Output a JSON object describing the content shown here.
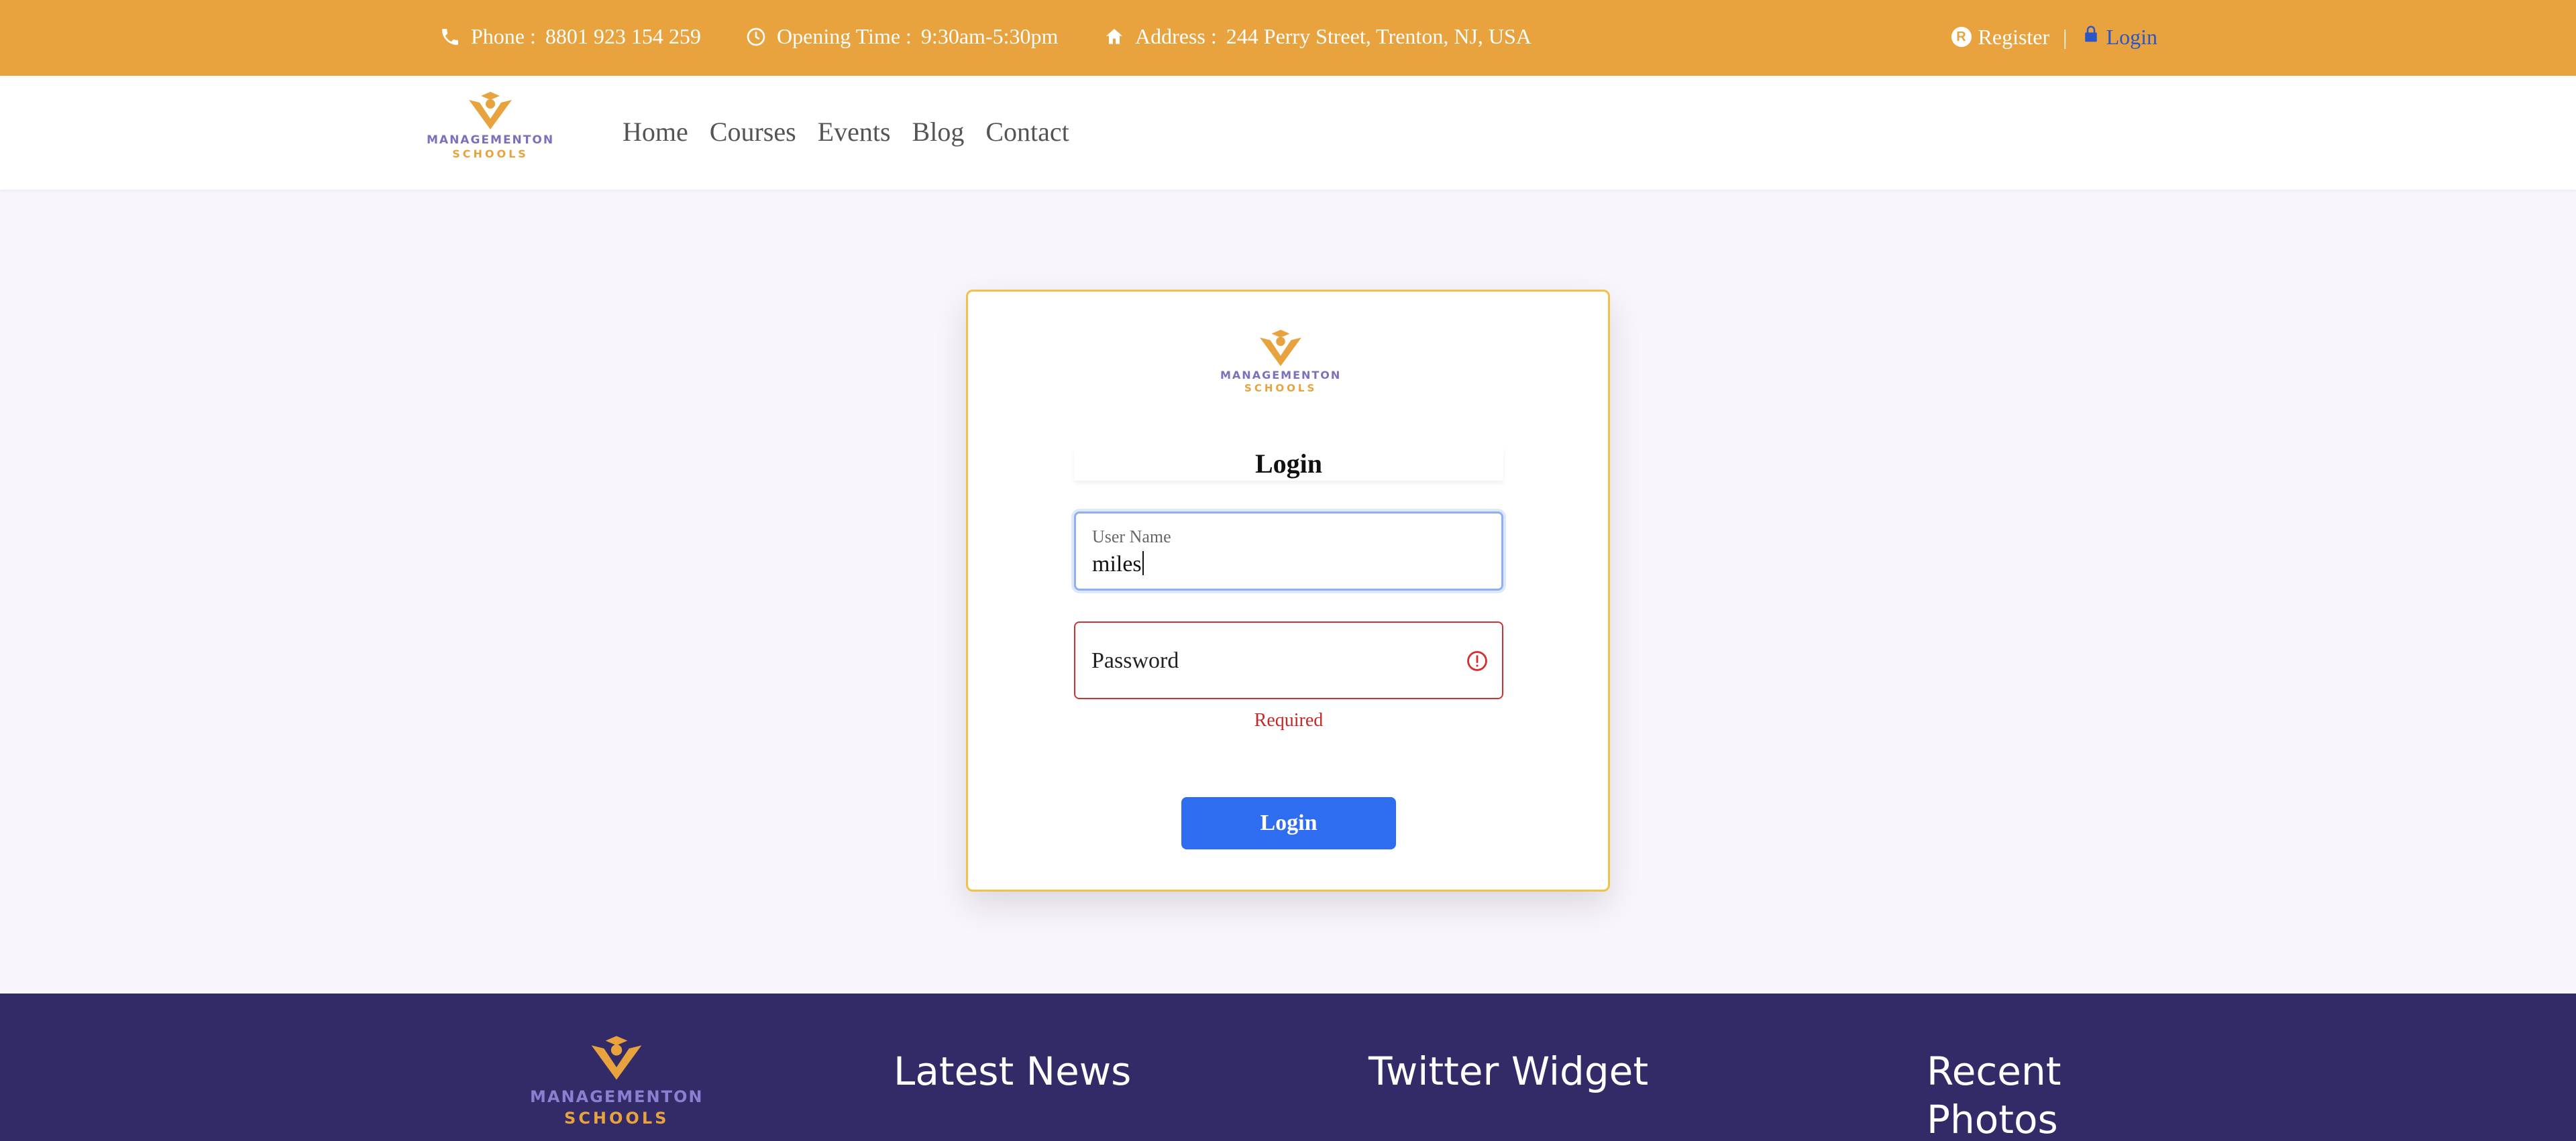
{
  "topbar": {
    "phone_label": "Phone :",
    "phone_value": "8801 923 154 259",
    "hours_label": "Opening Time :",
    "hours_value": "9:30am-5:30pm",
    "address_label": "Address :",
    "address_value": "244 Perry Street, Trenton, NJ, USA",
    "register": "Register",
    "separator": "|",
    "login": "Login",
    "register_badge": "R"
  },
  "brand": {
    "line1": "MANAGEMENTON",
    "line2": "SCHOOLS"
  },
  "nav": {
    "items": [
      "Home",
      "Courses",
      "Events",
      "Blog",
      "Contact"
    ]
  },
  "login_form": {
    "title": "Login",
    "username_label": "User Name",
    "username_value": "miles",
    "password_placeholder": "Password",
    "password_error": "Required",
    "submit_label": "Login"
  },
  "footer": {
    "latest_news": "Latest News",
    "twitter_widget": "Twitter Widget",
    "recent_photos": "Recent Photos"
  },
  "colors": {
    "topbar": "#e8a23e",
    "primary": "#2f6df0",
    "error": "#d32f2f",
    "footer": "#332a68",
    "brand_purple": "#7b6fbe"
  },
  "icons": {
    "phone": "phone-icon",
    "clock": "clock-icon",
    "home": "home-icon",
    "register": "register-icon",
    "lock": "lock-icon",
    "error": "error-icon",
    "logo": "graduation-logo-icon"
  }
}
